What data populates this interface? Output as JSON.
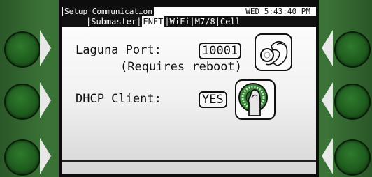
{
  "header": {
    "title": "Setup Communication",
    "clock": "WED 5:43:40 PM"
  },
  "tabs": [
    {
      "label": "Submaster",
      "active": false
    },
    {
      "label": "ENET",
      "active": true
    },
    {
      "label": "WiFi",
      "active": false
    },
    {
      "label": "M7/8",
      "active": false
    },
    {
      "label": "Cell",
      "active": false
    }
  ],
  "tab_separator": "|",
  "settings": {
    "laguna_port": {
      "label": "Laguna Port:",
      "value": "10001",
      "note": "(Requires reboot)"
    },
    "dhcp_client": {
      "label": "DHCP Client:",
      "value": "YES"
    }
  },
  "icons": {
    "port_hint": "hand-pinch-dial-icon",
    "dhcp_hint": "finger-press-knob-icon"
  },
  "colors": {
    "bezel": "#2f6a2e",
    "softkey": "#1f5c1e",
    "screen_text": "#111111"
  }
}
